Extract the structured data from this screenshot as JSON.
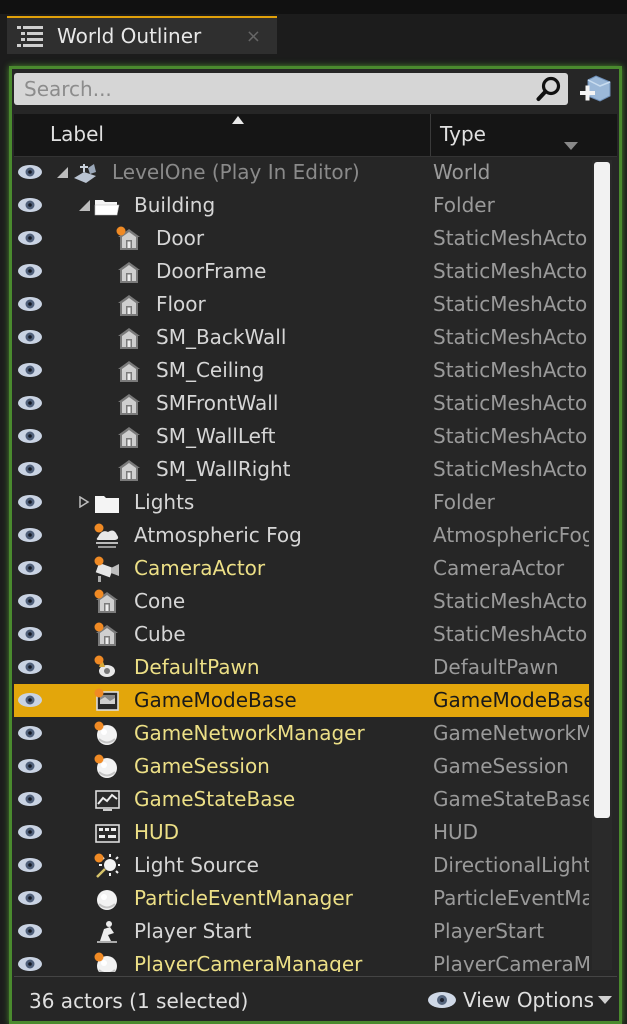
{
  "tab": {
    "title": "World Outliner",
    "close": "×"
  },
  "search": {
    "placeholder": "Search...",
    "value": ""
  },
  "columns": {
    "label": "Label",
    "type": "Type"
  },
  "rows": [
    {
      "label": "LevelOne (Play In Editor)",
      "type": "World",
      "icon": "world-icon",
      "indent": 0,
      "expand": "expanded",
      "style": "dim",
      "badge": false
    },
    {
      "label": "Building",
      "type": "Folder",
      "icon": "folder-open-icon",
      "indent": 1,
      "expand": "expanded",
      "style": "normal",
      "badge": false
    },
    {
      "label": "Door",
      "type": "StaticMeshActor",
      "icon": "static-mesh-icon",
      "indent": 2,
      "expand": "none",
      "style": "normal",
      "badge": true
    },
    {
      "label": "DoorFrame",
      "type": "StaticMeshActor",
      "icon": "static-mesh-icon",
      "indent": 2,
      "expand": "none",
      "style": "normal",
      "badge": false
    },
    {
      "label": "Floor",
      "type": "StaticMeshActor",
      "icon": "static-mesh-icon",
      "indent": 2,
      "expand": "none",
      "style": "normal",
      "badge": false
    },
    {
      "label": "SM_BackWall",
      "type": "StaticMeshActor",
      "icon": "static-mesh-icon",
      "indent": 2,
      "expand": "none",
      "style": "normal",
      "badge": false
    },
    {
      "label": "SM_Ceiling",
      "type": "StaticMeshActor",
      "icon": "static-mesh-icon",
      "indent": 2,
      "expand": "none",
      "style": "normal",
      "badge": false
    },
    {
      "label": "SMFrontWall",
      "type": "StaticMeshActor",
      "icon": "static-mesh-icon",
      "indent": 2,
      "expand": "none",
      "style": "normal",
      "badge": false
    },
    {
      "label": "SM_WallLeft",
      "type": "StaticMeshActor",
      "icon": "static-mesh-icon",
      "indent": 2,
      "expand": "none",
      "style": "normal",
      "badge": false
    },
    {
      "label": "SM_WallRight",
      "type": "StaticMeshActor",
      "icon": "static-mesh-icon",
      "indent": 2,
      "expand": "none",
      "style": "normal",
      "badge": false
    },
    {
      "label": "Lights",
      "type": "Folder",
      "icon": "folder-closed-icon",
      "indent": 1,
      "expand": "collapsed",
      "style": "normal",
      "badge": false
    },
    {
      "label": "Atmospheric Fog",
      "type": "AtmosphericFog",
      "icon": "atmospheric-fog-icon",
      "indent": 1,
      "expand": "none",
      "style": "normal",
      "badge": true
    },
    {
      "label": "CameraActor",
      "type": "CameraActor",
      "icon": "camera-icon",
      "indent": 1,
      "expand": "none",
      "style": "yellow",
      "badge": true
    },
    {
      "label": "Cone",
      "type": "StaticMeshActor",
      "icon": "static-mesh-icon",
      "indent": 1,
      "expand": "none",
      "style": "normal",
      "badge": true
    },
    {
      "label": "Cube",
      "type": "StaticMeshActor",
      "icon": "static-mesh-icon",
      "indent": 1,
      "expand": "none",
      "style": "normal",
      "badge": true
    },
    {
      "label": "DefaultPawn",
      "type": "DefaultPawn",
      "icon": "pawn-icon",
      "indent": 1,
      "expand": "none",
      "style": "yellow",
      "badge": true
    },
    {
      "label": "GameModeBase",
      "type": "GameModeBase",
      "icon": "game-mode-icon",
      "indent": 1,
      "expand": "none",
      "style": "yellow",
      "badge": true,
      "selected": true
    },
    {
      "label": "GameNetworkManager",
      "type": "GameNetworkManager",
      "icon": "sphere-icon",
      "indent": 1,
      "expand": "none",
      "style": "yellow",
      "badge": true
    },
    {
      "label": "GameSession",
      "type": "GameSession",
      "icon": "sphere-icon",
      "indent": 1,
      "expand": "none",
      "style": "yellow",
      "badge": true
    },
    {
      "label": "GameStateBase",
      "type": "GameStateBase",
      "icon": "game-state-icon",
      "indent": 1,
      "expand": "none",
      "style": "yellow",
      "badge": false
    },
    {
      "label": "HUD",
      "type": "HUD",
      "icon": "hud-icon",
      "indent": 1,
      "expand": "none",
      "style": "yellow",
      "badge": false
    },
    {
      "label": "Light Source",
      "type": "DirectionalLight",
      "icon": "directional-light-icon",
      "indent": 1,
      "expand": "none",
      "style": "normal",
      "badge": true
    },
    {
      "label": "ParticleEventManager",
      "type": "ParticleEventManager",
      "icon": "sphere-icon",
      "indent": 1,
      "expand": "none",
      "style": "yellow",
      "badge": false
    },
    {
      "label": "Player Start",
      "type": "PlayerStart",
      "icon": "player-start-icon",
      "indent": 1,
      "expand": "none",
      "style": "normal",
      "badge": false
    },
    {
      "label": "PlayerCameraManager",
      "type": "PlayerCameraManager",
      "icon": "sphere-icon",
      "indent": 1,
      "expand": "none",
      "style": "yellow",
      "badge": true
    }
  ],
  "footer": {
    "count": "36 actors (1 selected)",
    "view_options": "View Options"
  },
  "colors": {
    "selection": "#e3a60b",
    "accent_border": "#4a8a2e",
    "yellow_text": "#ecdf86",
    "badge": "#f08a24"
  }
}
